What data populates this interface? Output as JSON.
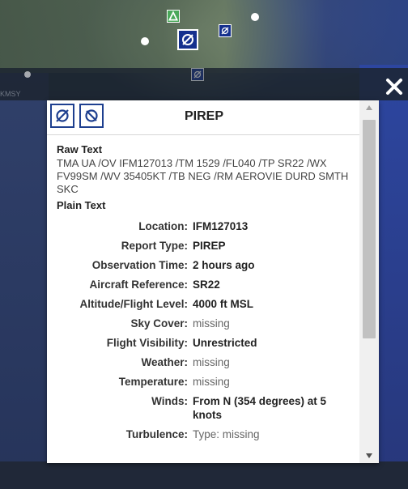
{
  "map": {
    "edge_label": "KMSY"
  },
  "popup": {
    "title": "PIREP",
    "raw_heading": "Raw Text",
    "raw_text": "TMA UA /OV IFM127013 /TM 1529 /FL040 /TP SR22 /WX FV99SM /WV 35405KT /TB NEG /RM AEROVIE DURD SMTH SKC",
    "plain_heading": "Plain Text",
    "fields": [
      {
        "label": "Location:",
        "value": "IFM127013",
        "missing": false
      },
      {
        "label": "Report Type:",
        "value": "PIREP",
        "missing": false
      },
      {
        "label": "Observation Time:",
        "value": "2 hours ago",
        "missing": false
      },
      {
        "label": "Aircraft Reference:",
        "value": "SR22",
        "missing": false
      },
      {
        "label": "Altitude/Flight Level:",
        "value": "4000 ft MSL",
        "missing": false
      },
      {
        "label": "Sky Cover:",
        "value": "missing",
        "missing": true
      },
      {
        "label": "Flight Visibility:",
        "value": "Unrestricted",
        "missing": false
      },
      {
        "label": "Weather:",
        "value": "missing",
        "missing": true
      },
      {
        "label": "Temperature:",
        "value": "missing",
        "missing": true
      },
      {
        "label": "Winds:",
        "value": "From N (354 degrees) at 5 knots",
        "missing": false
      },
      {
        "label": "Turbulence:",
        "value": "Type: missing",
        "missing": true
      }
    ]
  },
  "colors": {
    "marker_blue": "#15308e",
    "icon_border": "#1e3f8f",
    "marker_green": "#4aa85a"
  },
  "icons": {
    "close": "close-icon",
    "pirep": "pirep-icon",
    "pirep_no_turb": "pirep-null-icon"
  }
}
